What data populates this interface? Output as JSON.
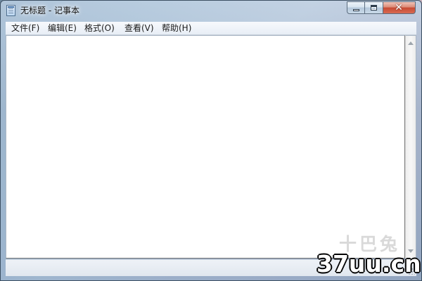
{
  "window": {
    "title": "无标题 - 记事本",
    "app_icon": "notepad-icon",
    "controls": {
      "minimize_icon": "minimize-icon",
      "maximize_icon": "maximize-icon",
      "close_icon": "close-icon",
      "close_glyph": "✕"
    }
  },
  "menubar": {
    "items": [
      {
        "label": "文件(F)"
      },
      {
        "label": "编辑(E)"
      },
      {
        "label": "格式(O)"
      },
      {
        "label": "查看(V)"
      },
      {
        "label": "帮助(H)"
      }
    ]
  },
  "editor": {
    "content": ""
  },
  "scrollbar": {
    "up_icon": "scroll-up-arrow-icon",
    "down_icon": "scroll-down-arrow-icon"
  },
  "watermark": {
    "logo_text": "十巴兔",
    "site": "37uu.cn"
  },
  "colors": {
    "close_button": "#c74a33",
    "editor_background": "#ffffff",
    "frame_tint": "#9fb9d2"
  }
}
